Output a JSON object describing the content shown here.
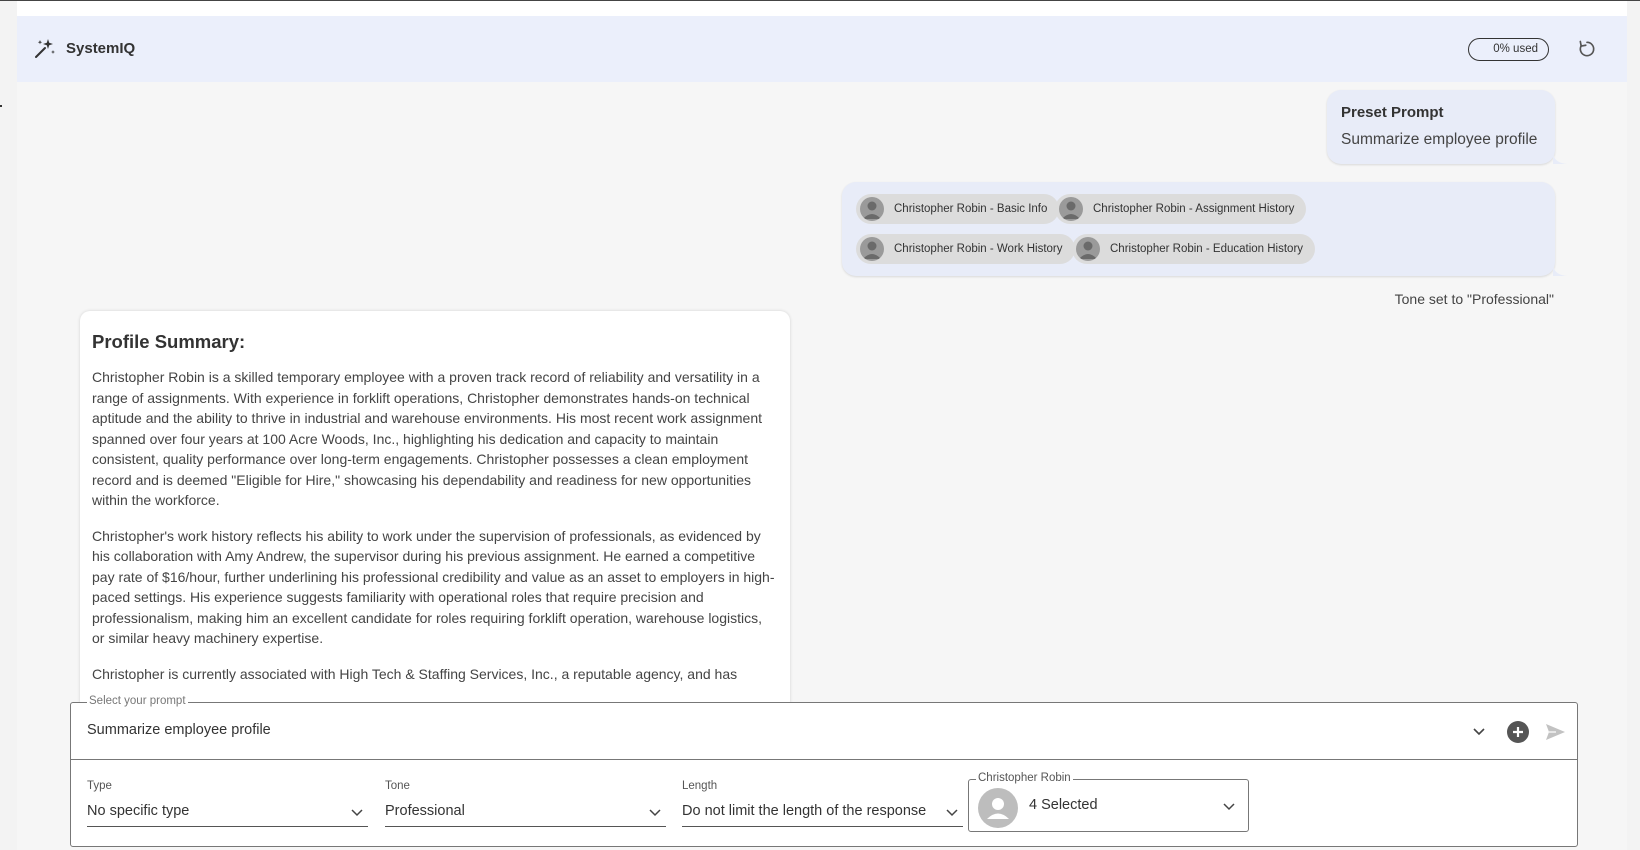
{
  "app": {
    "title": "SystemIQ",
    "usage": "0% used"
  },
  "preset": {
    "label": "Preset Prompt",
    "value": "Summarize employee profile"
  },
  "chips": [
    {
      "label": "Christopher Robin - Basic Info"
    },
    {
      "label": "Christopher Robin - Assignment History"
    },
    {
      "label": "Christopher Robin - Work History"
    },
    {
      "label": "Christopher Robin - Education History"
    }
  ],
  "tone_note": "Tone set to \"Professional\"",
  "answer": {
    "heading": "Profile Summary:",
    "paragraphs": [
      "Christopher Robin is a skilled temporary employee with a proven track record of reliability and versatility in a range of assignments. With experience in forklift operations, Christopher demonstrates hands-on technical aptitude and the ability to thrive in industrial and warehouse environments. His most recent work assignment spanned over four years at 100 Acre Woods, Inc., highlighting his dedication and capacity to maintain consistent, quality performance over long-term engagements. Christopher possesses a clean employment record and is deemed \"Eligible for Hire,\" showcasing his dependability and readiness for new opportunities within the workforce.",
      "Christopher's work history reflects his ability to work under the supervision of professionals, as evidenced by his collaboration with Amy Andrew, the supervisor during his previous assignment. He earned a competitive pay rate of $16/hour, further underlining his professional credibility and value as an asset to employers in high-paced settings. His experience suggests familiarity with operational roles that require precision and professionalism, making him an excellent candidate for roles requiring forklift operation, warehouse logistics, or similar heavy machinery expertise.",
      "Christopher is currently associated with High Tech & Staffing Services, Inc., a reputable agency, and has"
    ]
  },
  "composer": {
    "prompt_label": "Select your prompt",
    "prompt_value": "Summarize employee profile",
    "type": {
      "label": "Type",
      "value": "No specific type"
    },
    "tone": {
      "label": "Tone",
      "value": "Professional"
    },
    "length": {
      "label": "Length",
      "value": "Do not limit the length of the response"
    },
    "people": {
      "label": "Christopher Robin",
      "value": "4 Selected"
    }
  },
  "icons": {
    "brand": "sparkle-icon",
    "refresh": "refresh-icon",
    "avatar": "person-avatar-icon",
    "chevron": "chevron-down-icon",
    "add": "plus-circle-icon",
    "send": "send-icon"
  },
  "colors": {
    "header_bg": "#ebeffb",
    "bubble_bg": "#e8ecf8",
    "panel_bg": "#f6f6f6"
  }
}
